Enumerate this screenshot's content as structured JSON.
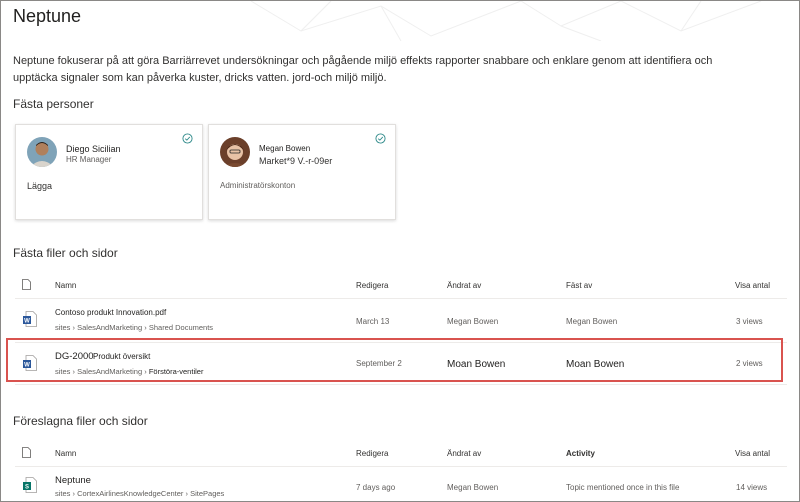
{
  "page": {
    "title": "Neptune",
    "description": "Neptune fokuserar på att göra Barriärrevet undersökningar och pågående miljö effekts rapporter snabbare och enklare genom att identifiera och upptäcka signaler som kan påverka kuster, dricks vatten. jord-och miljö miljö."
  },
  "pinned_people": {
    "title": "Fästa personer",
    "cards": [
      {
        "name": "Diego Sicilian",
        "role": "HR Manager",
        "extra": "Lägga"
      },
      {
        "name": "Megan Bowen",
        "role": "Market*9 V.-r-09er",
        "extra": "Administratörskonton"
      }
    ]
  },
  "pinned_files": {
    "title": "Fästa filer och sidor",
    "columns": {
      "name": "Namn",
      "edited": "Redigera",
      "modified_by": "Ändrat av",
      "pinned_by": "Fäst av",
      "views": "Visa antal"
    },
    "rows": [
      {
        "name": "Contoso produkt Innovation.pdf",
        "crumb": [
          "sites",
          "SalesAndMarketing",
          "Shared Documents"
        ],
        "edited": "March 13",
        "modified_by": "Megan Bowen",
        "pinned_by": "Megan Bowen",
        "views": "3 views"
      },
      {
        "name_main": "DG-2000",
        "name_sub": "Produkt översikt",
        "crumb": [
          "sites",
          "SalesAndMarketing",
          "Förstöra-ventiler"
        ],
        "edited": "September 2",
        "modified_by": "Moan Bowen",
        "pinned_by": "Moan Bowen",
        "views": "2 views"
      }
    ]
  },
  "suggested_files": {
    "title": "Föreslagna filer och sidor",
    "columns": {
      "name": "Namn",
      "edited": "Redigera",
      "modified_by": "Ändrat av",
      "activity": "Activity",
      "views": "Visa antal"
    },
    "rows": [
      {
        "name": "Neptune",
        "crumb": [
          "sites",
          "CortexAirlinesKnowledgeCenter",
          "SitePages"
        ],
        "edited": "7 days ago",
        "modified_by": "Megan Bowen",
        "activity": "Topic mentioned once in this file",
        "views": "14 views"
      }
    ]
  },
  "crumb_separator": "›",
  "colors": {
    "highlight": "#d9534f",
    "word_blue": "#2b579a",
    "sway_green": "#077568",
    "check_teal": "#2f8a8a"
  }
}
